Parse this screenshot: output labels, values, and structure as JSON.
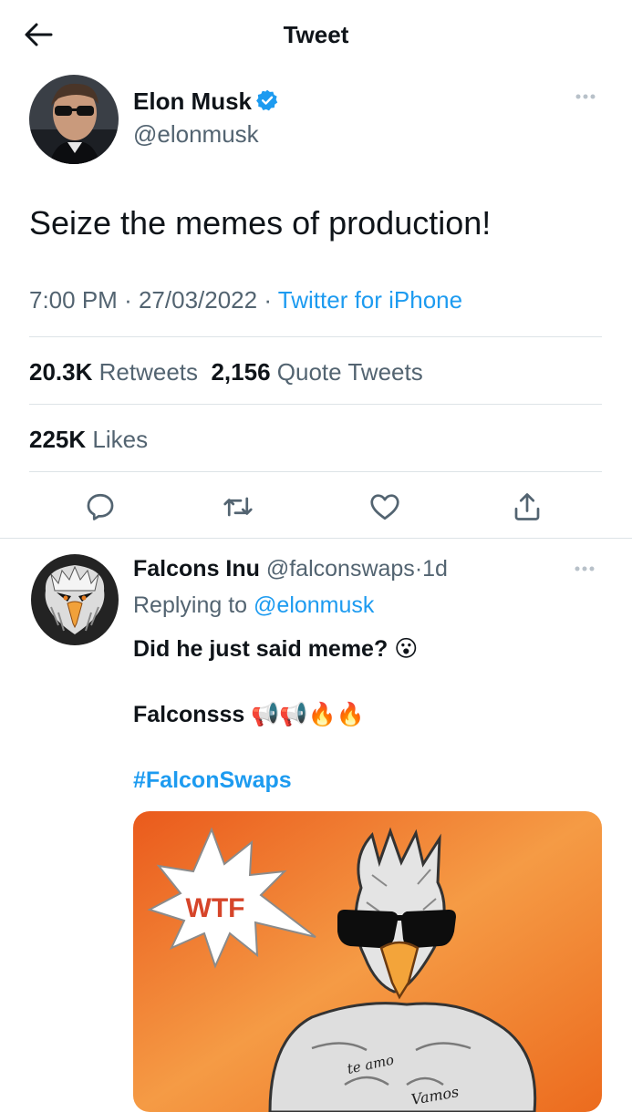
{
  "header": {
    "title": "Tweet",
    "back_icon": "arrow-left-icon"
  },
  "tweet": {
    "author_name": "Elon Musk",
    "author_handle": "@elonmusk",
    "verified": true,
    "text": "Seize the memes of production!",
    "time": "7:00 PM",
    "date": "27/03/2022",
    "separator": "·",
    "source": "Twitter for iPhone",
    "retweets_count": "20.3K",
    "retweets_label": "Retweets",
    "quote_count": "2,156",
    "quote_label": "Quote Tweets",
    "likes_count": "225K",
    "likes_label": "Likes"
  },
  "actions": [
    "reply-icon",
    "retweet-icon",
    "like-icon",
    "share-icon"
  ],
  "reply": {
    "author_name": "Falcons Inu",
    "author_handle": "@falconswaps",
    "age": "1d",
    "dot": "·",
    "replying_prefix": "Replying to",
    "replying_to": "@elonmusk",
    "line1": "Did he just said meme?",
    "line1_emoji": "😮",
    "line2": "Falconsss",
    "line2_emoji": "📢📢🔥🔥",
    "hashtag": "#FalconSwaps",
    "media_caption": "WTF",
    "media_chest_text": "te amo",
    "media_arm_text": "Vamos"
  },
  "colors": {
    "accent": "#1d9bf0",
    "text": "#0f1419",
    "muted": "#536471",
    "divider": "#dde3e7",
    "orange": "#f07a1e"
  }
}
